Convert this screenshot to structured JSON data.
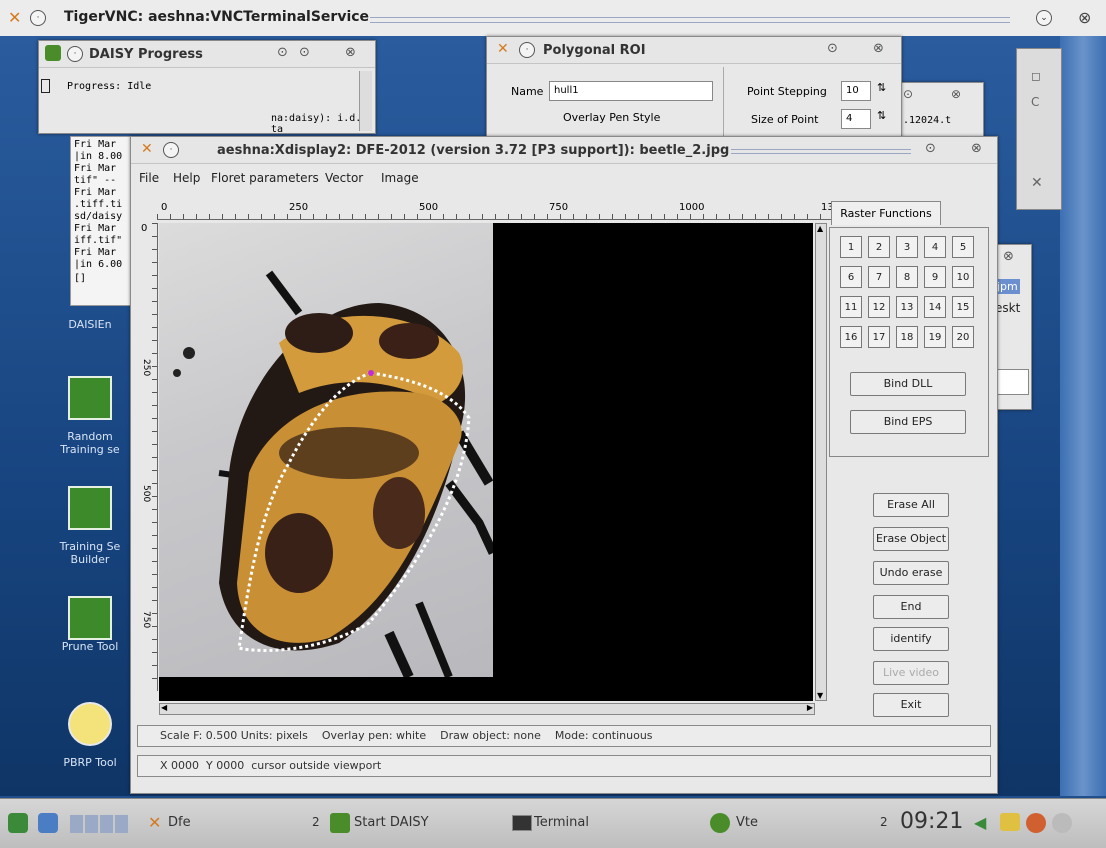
{
  "vnc": {
    "title": "TigerVNC: aeshna:VNCTerminalService"
  },
  "daisy": {
    "title": "DAISY Progress",
    "progress_label": "Progress: Idle",
    "snippet": "na:daisy): i.d. ta"
  },
  "terminal_lines": [
    "Fri Mar",
    "|in 8.00",
    "Fri Mar",
    "tif\" --",
    "Fri Mar",
    ".tiff.ti",
    "sd/daisy",
    "Fri Mar",
    "iff.tif\"",
    "Fri Mar",
    "|in 6.00",
    "[]"
  ],
  "roi": {
    "title": "Polygonal ROI",
    "name_label": "Name",
    "name_value": "hull1",
    "overlay_label": "Overlay Pen Style",
    "stepping_label": "Point Stepping",
    "stepping_value": "10",
    "size_label": "Size of Point",
    "size_value": "4"
  },
  "bg_window": {
    "value": ".12024.t"
  },
  "side_window": {
    "t1": "jpm",
    "t2": "eskt"
  },
  "main": {
    "title": "aeshna:Xdisplay2: DFE-2012 (version 3.72 [P3 support]): beetle_2.jpg",
    "menu": [
      "File",
      "Help",
      "Floret parameters",
      "Vector",
      "Image"
    ],
    "ruler_labels": [
      "0",
      "250",
      "500",
      "750",
      "1000",
      "13"
    ],
    "vruler_labels": [
      "0",
      "250",
      "500",
      "750"
    ],
    "raster_tab": "Raster Functions",
    "numbers": [
      "1",
      "2",
      "3",
      "4",
      "5",
      "6",
      "7",
      "8",
      "9",
      "10",
      "11",
      "12",
      "13",
      "14",
      "15",
      "16",
      "17",
      "18",
      "19",
      "20"
    ],
    "bind_dll": "Bind DLL",
    "bind_eps": "Bind EPS",
    "erase_all": "Erase All",
    "erase_object": "Erase Object",
    "undo_erase": "Undo erase",
    "end": "End",
    "identify": "identify",
    "live_video": "Live video",
    "exit": "Exit",
    "status1": "Scale F: 0.500 Units: pixels    Overlay pen: white    Draw object: none    Mode: continuous",
    "status2": "X 0000  Y 0000  cursor outside viewport"
  },
  "desktop_icons": [
    "DAISIEn",
    "Random Training se",
    "Training Se Builder",
    "Prune Tool",
    "PBRP Tool"
  ],
  "taskbar": {
    "dfe": "Dfe",
    "dfe_count": "2",
    "start_daisy": "Start DAISY",
    "terminal": "Terminal",
    "vte": "Vte",
    "vte_count": "2",
    "clock": "09:21"
  },
  "colors": {
    "desktop": "#1f4f8c",
    "window": "#e8e8e8",
    "canvas": "#000000",
    "beetle_orange": "#d49a3a",
    "beetle_dark": "#2a1c16"
  }
}
